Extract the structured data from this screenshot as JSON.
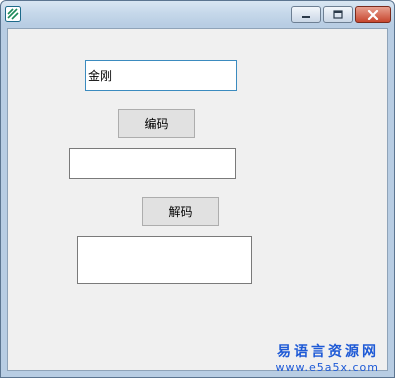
{
  "window": {
    "title": ""
  },
  "icons": {
    "app": "app-logo-icon",
    "minimize": "minimize-icon",
    "maximize": "maximize-icon",
    "close": "close-icon"
  },
  "colors": {
    "accent": "#1e5ad6",
    "close_button": "#c7462e",
    "client_bg": "#f0f0f0"
  },
  "form": {
    "input_value": "金刚",
    "encode_button": "编码",
    "encoded_value": "",
    "decode_button": "解码",
    "decoded_value": ""
  },
  "watermark": {
    "site_name": "易语言资源网",
    "site_url": "www.e5a5x.com"
  }
}
